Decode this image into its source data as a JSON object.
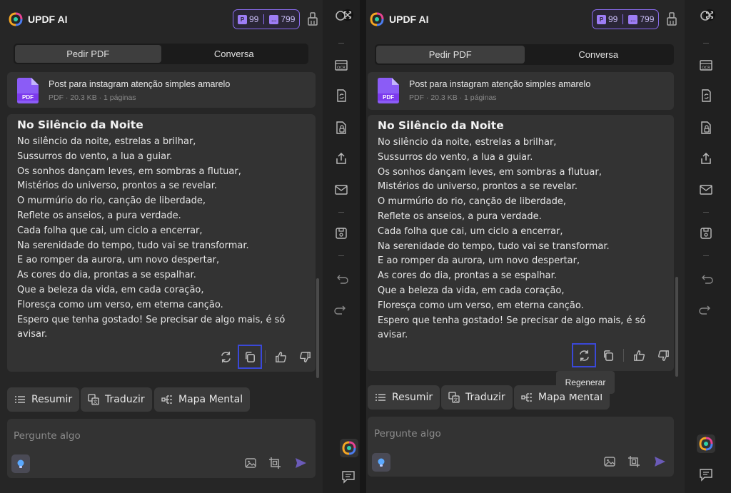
{
  "app": {
    "title": "UPDF AI"
  },
  "credits": {
    "pdf_count": "99",
    "chat_count": "799"
  },
  "tabs": [
    {
      "label": "Pedir PDF",
      "active": true
    },
    {
      "label": "Conversa",
      "active": false
    }
  ],
  "file": {
    "icon_label": "PDF",
    "name": "Post para instagram atenção simples amarelo",
    "meta": "PDF · 20.3 KB · 1 páginas"
  },
  "answer": {
    "title": "No Silêncio da Noite",
    "lines": [
      "No silêncio da noite, estrelas a brilhar,",
      "Sussurros do vento, a lua a guiar.",
      "Os sonhos dançam leves, em sombras a flutuar,",
      "Mistérios do universo, prontos a se revelar.",
      "O murmúrio do rio, canção de liberdade,",
      "Reflete os anseios, a pura verdade.",
      "Cada folha que cai, um ciclo a encerrar,",
      "Na serenidade do tempo, tudo vai se transformar.",
      "E ao romper da aurora, um novo despertar,",
      "As cores do dia, prontas a se espalhar.",
      "Que a beleza da vida, em cada coração,",
      "Floresça como um verso, em eterna canção.",
      "Espero que tenha gostado! Se precisar de algo mais, é só",
      "avisar."
    ]
  },
  "quick_actions": {
    "summarize": "Resumir",
    "translate": "Traduzir",
    "mindmap": "Mapa Mental"
  },
  "input": {
    "placeholder": "Pergunte algo"
  },
  "tooltip": {
    "regenerate": "Regenerar"
  },
  "colors": {
    "accent": "#8b6cf0",
    "highlight": "#3a48d8",
    "send": "#6b5bb8"
  },
  "icons": {
    "rail": [
      "expand-icon",
      "ocr-icon",
      "convert-icon",
      "protect-icon",
      "share-icon",
      "mail-icon",
      "save-icon",
      "undo-icon",
      "redo-icon",
      "updf-ai-icon",
      "comment-icon"
    ],
    "actions": [
      "regenerate-icon",
      "copy-icon",
      "thumbs-up-icon",
      "thumbs-down-icon"
    ]
  }
}
